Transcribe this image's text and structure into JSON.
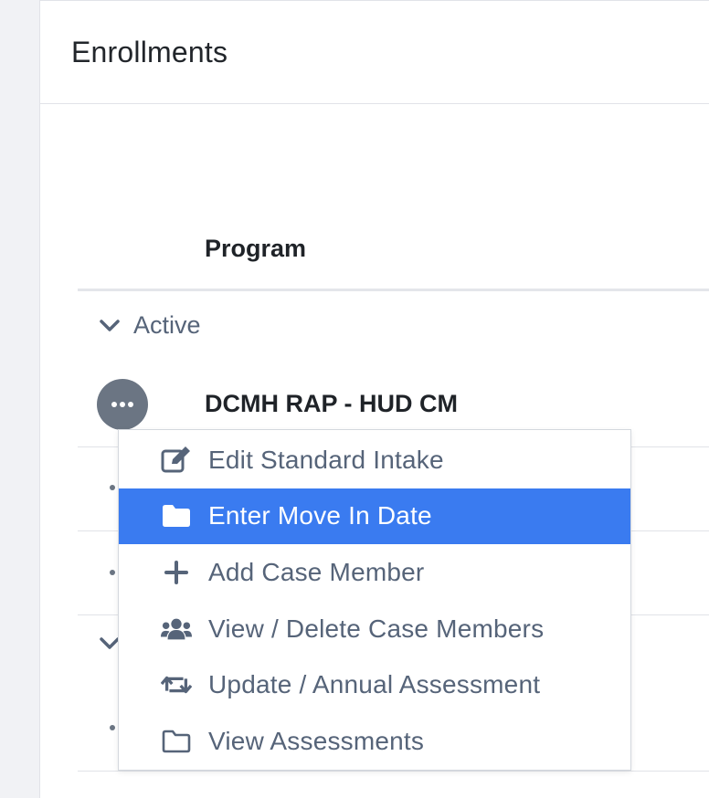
{
  "panel": {
    "title": "Enrollments"
  },
  "table": {
    "column_header": "Program",
    "groups": [
      {
        "label": "Active"
      }
    ],
    "rows": [
      {
        "program": "DCMH RAP - HUD CM"
      }
    ]
  },
  "context_menu": {
    "items": [
      {
        "label": "Edit Standard Intake",
        "icon": "edit-icon"
      },
      {
        "label": "Enter Move In Date",
        "icon": "folder-icon",
        "highlighted": true
      },
      {
        "label": "Add Case Member",
        "icon": "plus-icon"
      },
      {
        "label": "View / Delete Case Members",
        "icon": "users-icon"
      },
      {
        "label": "Update / Annual Assessment",
        "icon": "retweet-icon"
      },
      {
        "label": "View Assessments",
        "icon": "folder-outline-icon"
      }
    ]
  },
  "colors": {
    "highlight": "#3a7bf0",
    "menu_text": "#566479",
    "action_button": "#6b7583"
  }
}
